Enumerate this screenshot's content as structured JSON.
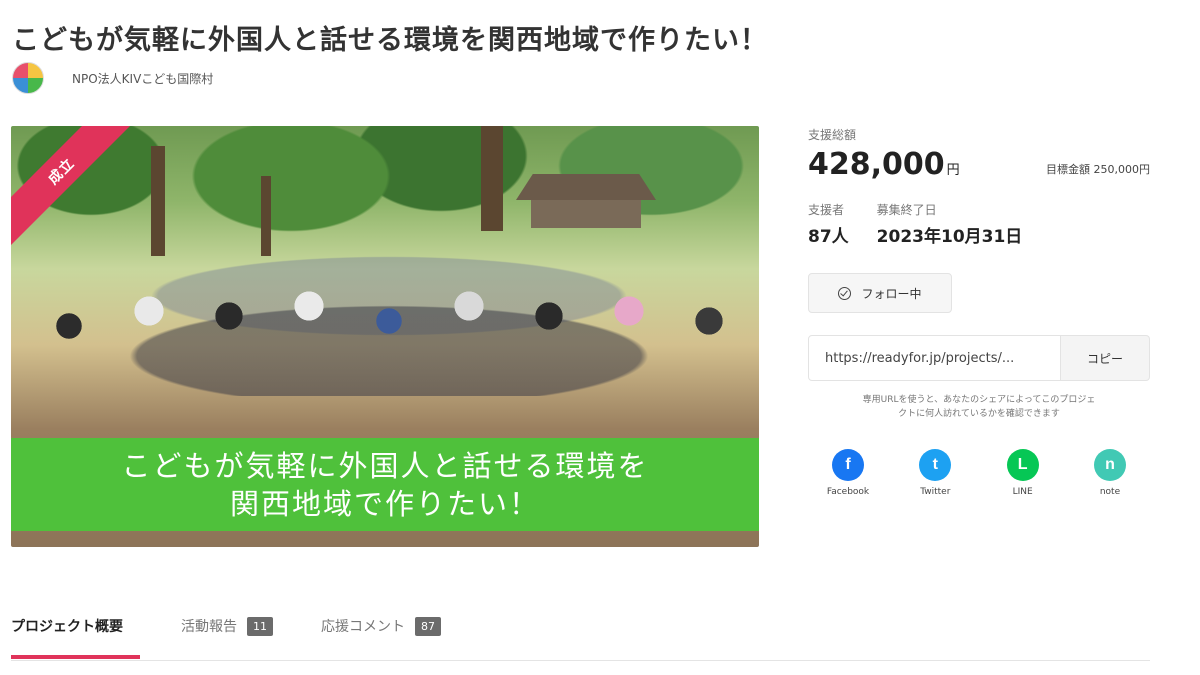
{
  "project": {
    "title": "こどもが気軽に外国人と話せる環境を関西地域で作りたい！",
    "owner_name": "NPO法人KIVこども国際村"
  },
  "hero": {
    "ribbon_label": "成立",
    "banner_line1": "こどもが気軽に外国人と話せる環境を",
    "banner_line2": "関西地域で作りたい！"
  },
  "support": {
    "total_label": "支援総額",
    "total_amount": "428,000",
    "currency": "円",
    "goal_text": "目標金額 250,000円",
    "supporters_label": "支援者",
    "supporters_value": "87人",
    "end_label": "募集終了日",
    "end_value": "2023年10月31日",
    "follow_label": "フォロー中"
  },
  "share": {
    "url": "https://readyfor.jp/projects/...",
    "copy_label": "コピー",
    "note_line1": "専用URLを使うと、あなたのシェアによってこのプロジェ",
    "note_line2": "クトに何人訪れているかを確認できます",
    "networks": [
      {
        "label": "Facebook",
        "icon": "facebook-icon",
        "color": "#1877f2",
        "glyph": "f"
      },
      {
        "label": "Twitter",
        "icon": "twitter-icon",
        "color": "#1da1f2",
        "glyph": "t"
      },
      {
        "label": "LINE",
        "icon": "line-icon",
        "color": "#06c755",
        "glyph": "L"
      },
      {
        "label": "note",
        "icon": "note-icon",
        "color": "#41c9b4",
        "glyph": "n"
      }
    ]
  },
  "tabs": [
    {
      "label": "プロジェクト概要",
      "active": true
    },
    {
      "label": "活動報告",
      "count": "11"
    },
    {
      "label": "応援コメント",
      "count": "87"
    }
  ],
  "colors": {
    "accent": "#e0335a",
    "banner_green": "#4fc13b"
  }
}
